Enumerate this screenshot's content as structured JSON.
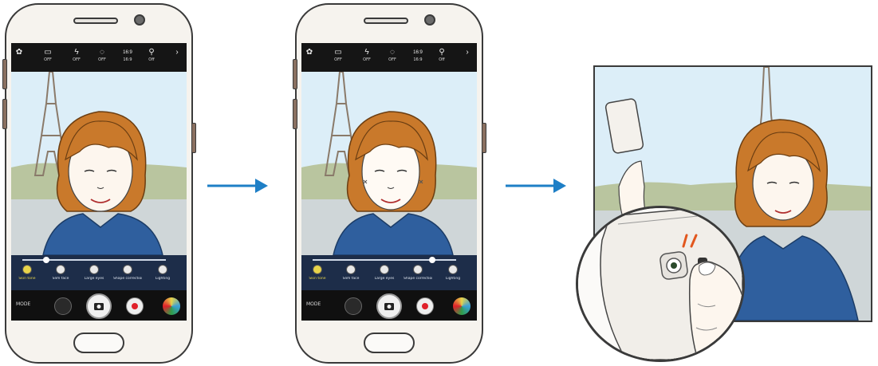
{
  "phones": [
    {
      "toolbar": [
        {
          "icon": "settings-icon",
          "label": ""
        },
        {
          "icon": "timer-icon",
          "label": "OFF"
        },
        {
          "icon": "flash-icon",
          "label": "OFF"
        },
        {
          "icon": "hdr-icon",
          "label": "OFF"
        },
        {
          "icon": "resolution-icon",
          "label": "16:9"
        },
        {
          "icon": "zoom-icon",
          "label": "Off"
        }
      ],
      "filters": [
        {
          "label": "Skin tone",
          "selected": true
        },
        {
          "label": "Slim face",
          "selected": false
        },
        {
          "label": "Large eyes",
          "selected": false
        },
        {
          "label": "Shape correction",
          "selected": false
        },
        {
          "label": "Lighting",
          "selected": false
        }
      ],
      "slider_value": 0.15,
      "mode_label": "MODE"
    },
    {
      "toolbar": [
        {
          "icon": "settings-icon",
          "label": ""
        },
        {
          "icon": "timer-icon",
          "label": "OFF"
        },
        {
          "icon": "flash-icon",
          "label": "OFF"
        },
        {
          "icon": "hdr-icon",
          "label": "OFF"
        },
        {
          "icon": "resolution-icon",
          "label": "16:9"
        },
        {
          "icon": "zoom-icon",
          "label": "Off"
        }
      ],
      "filters": [
        {
          "label": "Skin tone",
          "selected": true
        },
        {
          "label": "Slim face",
          "selected": false
        },
        {
          "label": "Large eyes",
          "selected": false
        },
        {
          "label": "Shape correction",
          "selected": false
        },
        {
          "label": "Lighting",
          "selected": false
        }
      ],
      "slider_value": 0.85,
      "mode_label": "MODE"
    }
  ],
  "colors": {
    "arrow": "#1e7fc6",
    "shirt": "#2f5f9e",
    "hair": "#c9792b",
    "skin": "#fdf6ee",
    "sky": "#dceef8",
    "tower": "#8a7a6a",
    "record": "#e0202a",
    "accent_yellow": "#e8d44a"
  }
}
